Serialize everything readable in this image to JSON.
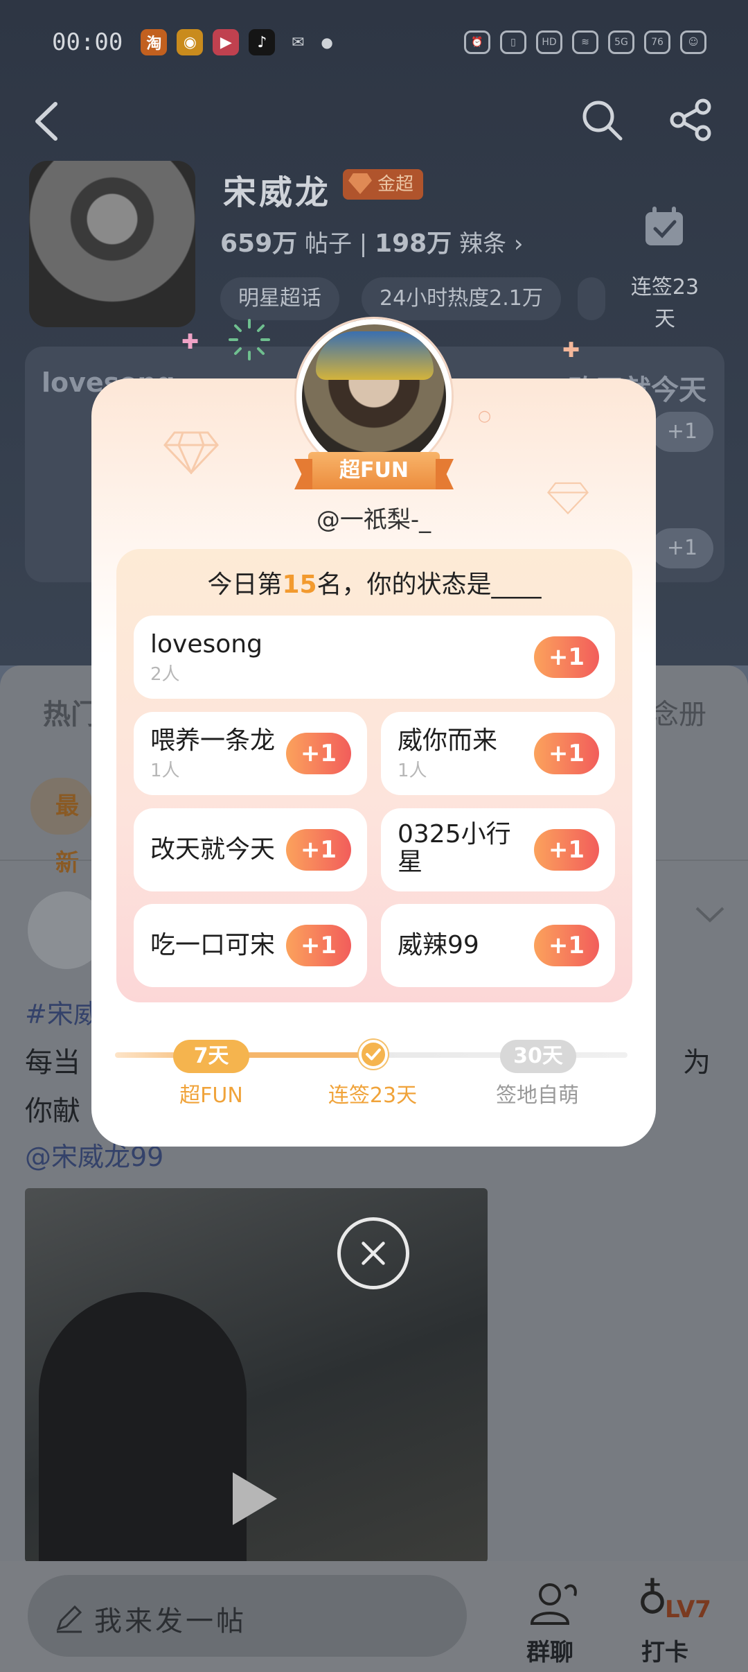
{
  "status_bar": {
    "time": "00:00",
    "apps": [
      {
        "name": "taobao-icon",
        "glyph": "淘",
        "color": "#f76b1c"
      },
      {
        "name": "weibo-icon",
        "glyph": "◉",
        "color": "#e89a1b"
      },
      {
        "name": "video-app-icon",
        "glyph": "▶",
        "color": "#e5475d"
      },
      {
        "name": "tiktok-icon",
        "glyph": "♪",
        "color": "#111111"
      },
      {
        "name": "wechat-icon",
        "glyph": "✉",
        "color": "#2a2f38"
      }
    ],
    "battery": "76"
  },
  "header": {
    "topic_name": "宋威龙",
    "badge": "金超",
    "posts_count": "659万",
    "posts_label": "帖子",
    "fans_count": "198万",
    "fans_label": "辣条",
    "chips": [
      "明星超话",
      "24小时热度2.1万"
    ],
    "checkin_label": "连签23天"
  },
  "background": {
    "panel_left_text": "lovesong",
    "panel_right_text": "改天就今天",
    "plus_label": "+1",
    "tab_hot": "热门",
    "tab_right": "念册",
    "pill_text": "最新",
    "hashtag": "#宋威",
    "line1_left": "每当",
    "line1_right": "为",
    "line2": "你献",
    "mention": "@宋威龙99",
    "post_placeholder": "我来发一帖",
    "group_chat": "群聊",
    "level": "LV7",
    "level_label": "打卡"
  },
  "modal": {
    "fun_badge": "超FUN",
    "username": "@一祇梨-_",
    "title_prefix": "今日第",
    "rank": "15",
    "title_suffix": "名，你的状态是____",
    "options": [
      {
        "name": "lovesong",
        "count": "2人",
        "plus": "+1"
      },
      {
        "name": "喂养一条龙",
        "count": "1人",
        "plus": "+1"
      },
      {
        "name": "威你而来",
        "count": "1人",
        "plus": "+1"
      },
      {
        "name": "改天就今天",
        "count": "",
        "plus": "+1"
      },
      {
        "name": "0325小行星",
        "count": "",
        "plus": "+1"
      },
      {
        "name": "吃一口可宋",
        "count": "",
        "plus": "+1"
      },
      {
        "name": "威辣99",
        "count": "",
        "plus": "+1"
      }
    ],
    "milestones": [
      {
        "pill": "7天",
        "label": "超FUN",
        "color": "#f5b44e",
        "label_color": "#f0a33a"
      },
      {
        "pill": "",
        "label": "连签23天",
        "color": "#f5b44e",
        "label_color": "#f0a33a"
      },
      {
        "pill": "30天",
        "label": "签地自萌",
        "color": "#d5d5d5",
        "label_color": "#9a9a9a"
      }
    ],
    "progress_fraction": 0.5
  },
  "colors": {
    "accent_orange": "#f29a2e",
    "plus_gradient_start": "#fba25c",
    "plus_gradient_end": "#f25d5b"
  }
}
